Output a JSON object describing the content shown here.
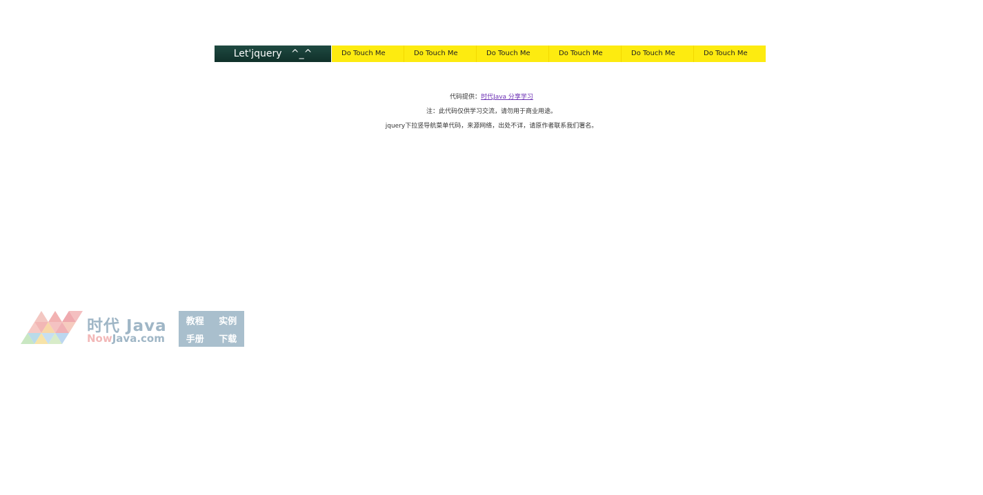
{
  "nav": {
    "brand": "Let'jquery   ^_^",
    "items": [
      {
        "label": "Do Touch Me"
      },
      {
        "label": "Do Touch Me"
      },
      {
        "label": "Do Touch Me"
      },
      {
        "label": "Do Touch Me"
      },
      {
        "label": "Do Touch Me"
      },
      {
        "label": "Do Touch Me"
      }
    ]
  },
  "info": {
    "provider_prefix": "代码提供：",
    "provider_link": "时代Java 分享学习",
    "notice": "注：此代码仅供学习交流，请勿用于商业用途。",
    "source": "jquery下拉竖导航菜单代码，来源网络，出处不详，请原作者联系我们署名。"
  },
  "watermark": {
    "title": "时代 Java",
    "domain_now": "Now",
    "domain_rest": "Java.com",
    "box": [
      "教程",
      "实例",
      "手册",
      "下载"
    ]
  },
  "colors": {
    "nav_brand_bg": "#16393a",
    "nav_item_bg": "#fdeb10",
    "link": "#6b2fb3"
  }
}
